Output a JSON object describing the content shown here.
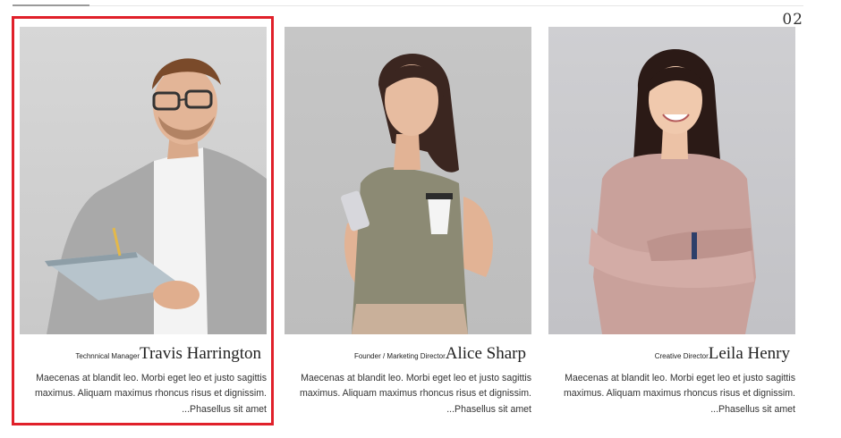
{
  "pager": {
    "current": "02"
  },
  "team": [
    {
      "role": "Technnical Manager",
      "name": "Travis Harrington",
      "description": "Maecenas at blandit leo. Morbi eget leo et justo sagittis maximus. Aliquam maximus rhoncus risus et dignissim.",
      "more": "...Phasellus sit amet"
    },
    {
      "role": "Founder / Marketing Director",
      "name": "Alice Sharp",
      "description": "Maecenas at blandit leo. Morbi eget leo et justo sagittis maximus. Aliquam maximus rhoncus risus et dignissim.",
      "more": "...Phasellus sit amet"
    },
    {
      "role": "Creative Director",
      "name": "Leila Henry",
      "description": "Maecenas at blandit leo. Morbi eget leo et justo sagittis maximus. Aliquam maximus rhoncus risus et dignissim.",
      "more": "...Phasellus sit amet"
    }
  ],
  "highlight": {
    "color": "#e0202a",
    "target": "Travis Harrington"
  },
  "icons": [
    "person-portrait-icon"
  ]
}
